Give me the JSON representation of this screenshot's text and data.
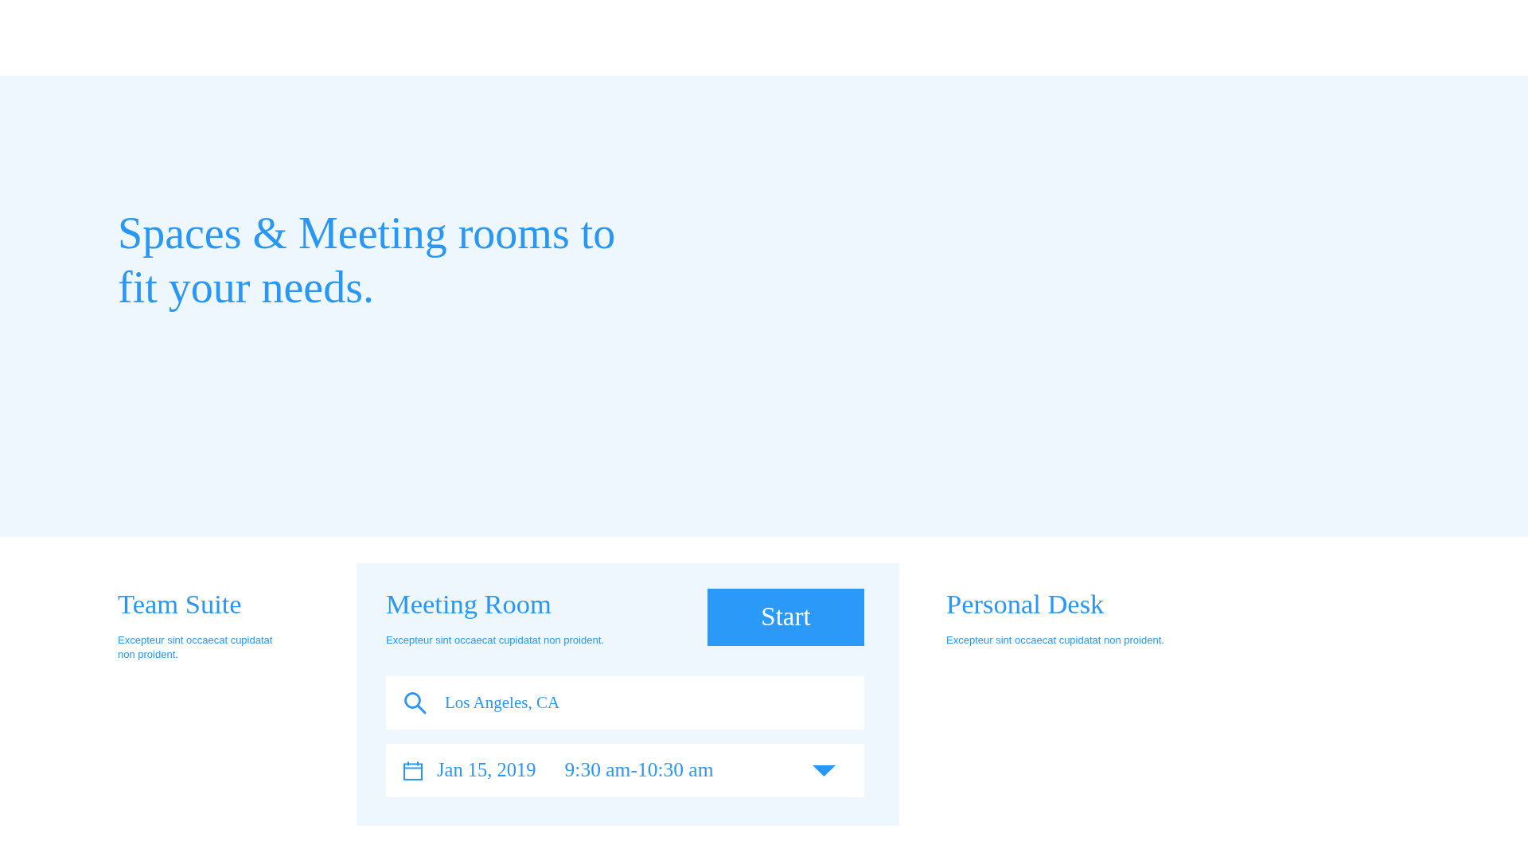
{
  "hero": {
    "headline": "Spaces & Meeting rooms to fit your needs."
  },
  "space_types": [
    {
      "title": "Team Suite",
      "description": "Excepteur sint occaecat cupidatat non proident.",
      "selected": false
    },
    {
      "title": "Meeting Room",
      "description": "Excepteur sint occaecat cupidatat non proident.",
      "selected": true
    },
    {
      "title": "Personal Desk",
      "description": "Excepteur sint occaecat cupidatat non proident.",
      "selected": false
    }
  ],
  "booking": {
    "button": "Start",
    "location": {
      "value": "Los Angeles, CA"
    },
    "date": "Jan 15, 2019",
    "time": "9:30 am-10:30 am"
  }
}
